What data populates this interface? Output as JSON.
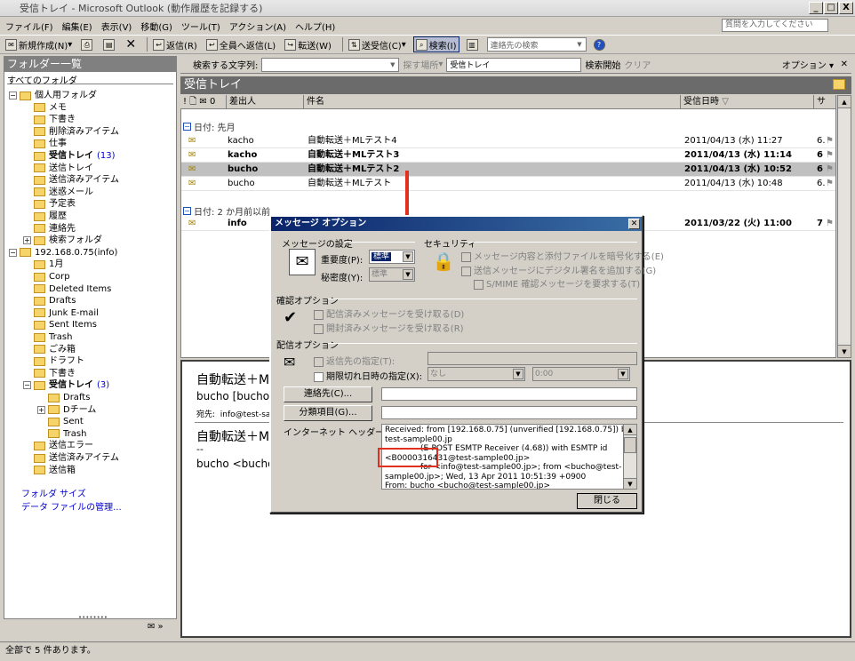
{
  "window": {
    "title": "受信トレイ - Microsoft Outlook (動作履歴を記録する)",
    "min": "_",
    "max": "□",
    "close": "X"
  },
  "menu": [
    "ファイル(F)",
    "編集(E)",
    "表示(V)",
    "移動(G)",
    "ツール(T)",
    "アクション(A)",
    "ヘルプ(H)"
  ],
  "help_placeholder": "質問を入力してください",
  "toolbar": {
    "new": "新規作成(N)",
    "reply": "返信(R)",
    "reply_all": "全員へ返信(L)",
    "forward": "転送(W)",
    "send_receive": "送受信(C)",
    "find": "検索(I)",
    "contact_search": "連絡先の検索"
  },
  "folders": {
    "header": "フォルダー一覧",
    "all": "すべてのフォルダ",
    "items": [
      {
        "label": "個人用フォルダ",
        "level": 0,
        "exp": "⊟"
      },
      {
        "label": "メモ",
        "level": 1
      },
      {
        "label": "下書き",
        "level": 1
      },
      {
        "label": "削除済みアイテム",
        "level": 1
      },
      {
        "label": "仕事",
        "level": 1
      },
      {
        "label": "受信トレイ",
        "level": 1,
        "bold": true,
        "count": "(13)"
      },
      {
        "label": "送信トレイ",
        "level": 1
      },
      {
        "label": "送信済みアイテム",
        "level": 1
      },
      {
        "label": "迷惑メール",
        "level": 1
      },
      {
        "label": "予定表",
        "level": 1
      },
      {
        "label": "履歴",
        "level": 1
      },
      {
        "label": "連絡先",
        "level": 1
      },
      {
        "label": "検索フォルダ",
        "level": 1,
        "exp": "⊞"
      },
      {
        "label": "192.168.0.75(info)",
        "level": 0,
        "exp": "⊟"
      },
      {
        "label": "1月",
        "level": 1
      },
      {
        "label": "Corp",
        "level": 1
      },
      {
        "label": "Deleted Items",
        "level": 1
      },
      {
        "label": "Drafts",
        "level": 1
      },
      {
        "label": "Junk E-mail",
        "level": 1
      },
      {
        "label": "Sent Items",
        "level": 1
      },
      {
        "label": "Trash",
        "level": 1
      },
      {
        "label": "ごみ箱",
        "level": 1
      },
      {
        "label": "ドラフト",
        "level": 1
      },
      {
        "label": "下書き",
        "level": 1
      },
      {
        "label": "受信トレイ",
        "level": 1,
        "bold": true,
        "count": "(3)",
        "exp": "⊟"
      },
      {
        "label": "Drafts",
        "level": 2
      },
      {
        "label": "Dチーム",
        "level": 2,
        "exp": "⊞"
      },
      {
        "label": "Sent",
        "level": 2
      },
      {
        "label": "Trash",
        "level": 2
      },
      {
        "label": "送信エラー",
        "level": 1
      },
      {
        "label": "送信済みアイテム",
        "level": 1
      },
      {
        "label": "送信箱",
        "level": 1
      }
    ],
    "folder_size": "フォルダ サイズ",
    "data_file": "データ ファイルの管理..."
  },
  "search": {
    "label": "検索する文字列:",
    "scope_label": "探す場所",
    "scope": "受信トレイ",
    "start": "検索開始",
    "clear": "クリア",
    "options": "オプション"
  },
  "list": {
    "title": "受信トレイ",
    "columns": {
      "icons": "! 🗋 ✉ 0",
      "from": "差出人",
      "subject": "件名",
      "received": "受信日時",
      "size": "サ"
    },
    "groups": [
      {
        "label": "日付: 先月"
      },
      {
        "label": "日付: 2 か月前以前"
      }
    ],
    "rows": [
      {
        "from": "kacho",
        "subject": "自動転送＋MLテスト4",
        "date": "2011/04/13 (水) 11:27",
        "size": "6.",
        "bold": false,
        "sel": false
      },
      {
        "from": "kacho",
        "subject": "自動転送＋MLテスト3",
        "date": "2011/04/13 (水) 11:14",
        "size": "6",
        "bold": true,
        "sel": false
      },
      {
        "from": "bucho",
        "subject": "自動転送＋MLテスト2",
        "date": "2011/04/13 (水) 10:52",
        "size": "6",
        "bold": true,
        "sel": true
      },
      {
        "from": "bucho",
        "subject": "自動転送＋MLテスト",
        "date": "2011/04/13 (水) 10:48",
        "size": "6.",
        "bold": false,
        "sel": false
      },
      {
        "from": "info",
        "subject": "",
        "date": "2011/03/22 (火) 11:00",
        "size": "7",
        "bold": true,
        "sel": false
      }
    ]
  },
  "preview": {
    "subject": "自動転送＋ML",
    "from": "bucho [bucho@",
    "to_label": "宛先:",
    "to": "info@test-sa",
    "body_title": "自動転送＋ML",
    "dash": "--",
    "sig": "bucho <bucho@"
  },
  "dialog": {
    "title": "メッセージ オプション",
    "msg_settings": "メッセージの設定",
    "importance": "重要度(P):",
    "importance_val": "標準",
    "sensitivity": "秘密度(Y):",
    "sensitivity_val": "標準",
    "security": "セキュリティ",
    "encrypt": "メッセージ内容と添付ファイルを暗号化する(E)",
    "sign": "送信メッセージにデジタル署名を追加する(G)",
    "smime": "S/MIME 確認メッセージを要求する(T)",
    "confirm": "確認オプション",
    "read_receipt1": "配信済みメッセージを受け取る(D)",
    "read_receipt2": "開封済みメッセージを受け取る(R)",
    "delivery": "配信オプション",
    "reply_to": "返信先の指定(T):",
    "expire": "期限切れ日時の指定(X):",
    "expire_date": "なし",
    "expire_time": "0:00",
    "contacts_btn": "連絡先(C)...",
    "category_btn": "分類項目(G)...",
    "headers_label": "インターネット ヘッダー(H):",
    "headers": [
      "Received: from [192.168.0.75] (unverified [192.168.0.75]) by",
      "test-sample00.jp",
      "(E-POST ESMTP Receiver (4.68)) with ESMTP id",
      "<B0000316431@test-sample00.jp>",
      "for <info@test-sample00.jp>;  from <bucho@test-",
      "sample00.jp>; Wed, 13 Apr 2011 10:51:39 +0900",
      "From: bucho <bucho@test-sample00.jp>"
    ],
    "close": "閉じる"
  },
  "status": "全部で 5 件あります。"
}
